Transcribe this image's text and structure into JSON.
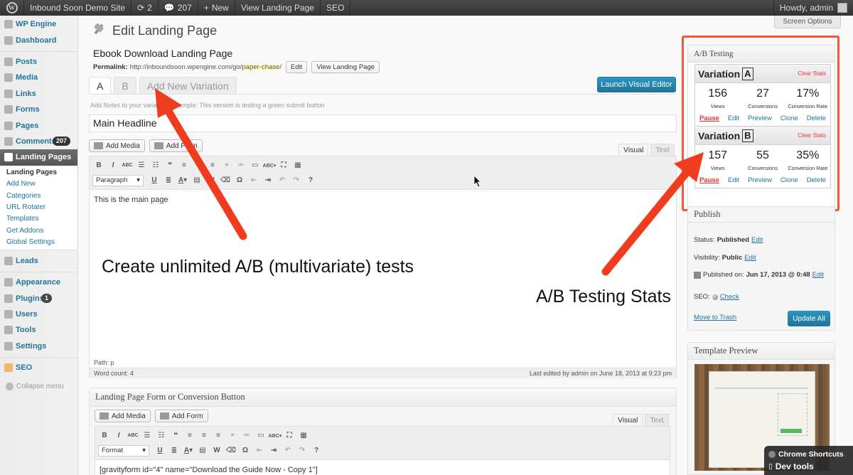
{
  "adminbar": {
    "site": "Inbound Soon Demo Site",
    "updates": "2",
    "comments": "207",
    "new": "New",
    "view": "View Landing Page",
    "seo": "SEO",
    "howdy": "Howdy, admin"
  },
  "sidebar": {
    "items": [
      {
        "label": "WP Engine",
        "icon": "wp-engine-icon"
      },
      {
        "label": "Dashboard",
        "icon": "dashboard-icon"
      },
      {
        "label": "Posts",
        "icon": "pin-icon"
      },
      {
        "label": "Media",
        "icon": "media-icon"
      },
      {
        "label": "Links",
        "icon": "link-icon"
      },
      {
        "label": "Forms",
        "icon": "forms-icon"
      },
      {
        "label": "Pages",
        "icon": "pages-icon"
      },
      {
        "label": "Comments",
        "icon": "comments-icon",
        "badge": "207"
      },
      {
        "label": "Landing Pages",
        "icon": "landing-pages-icon"
      },
      {
        "label": "Leads",
        "icon": "leads-icon"
      },
      {
        "label": "Appearance",
        "icon": "appearance-icon"
      },
      {
        "label": "Plugins",
        "icon": "plugins-icon",
        "badge": "1"
      },
      {
        "label": "Users",
        "icon": "users-icon"
      },
      {
        "label": "Tools",
        "icon": "tools-icon"
      },
      {
        "label": "Settings",
        "icon": "settings-icon"
      },
      {
        "label": "SEO",
        "icon": "seo-icon"
      }
    ],
    "submenu": [
      "Landing Pages",
      "Add New",
      "Categories",
      "URL Rotater",
      "Templates",
      "Get Addons",
      "Global Settings"
    ],
    "collapse": "Collapse menu"
  },
  "page": {
    "title": "Edit Landing Page",
    "screen_options": "Screen Options",
    "post_title": "Ebook Download Landing Page",
    "permalink_label": "Permalink:",
    "permalink_base": "http://inboundsoon.wpengine.com/go/",
    "permalink_slug": "paper-chase",
    "permalink_end": "/",
    "edit_btn": "Edit",
    "view_btn": "View Landing Page"
  },
  "tabs": [
    "A",
    "B",
    "Add New Variation"
  ],
  "launch": "Launch Visual Editor",
  "notes_placeholder": "Add Notes to your variation. Example: This version is testing a green submit button",
  "headline": "Main Headline",
  "editor1": {
    "add_media": "Add Media",
    "add_form": "Add Form",
    "visual": "Visual",
    "text": "Text",
    "format": "Paragraph",
    "content": "This is the main page",
    "path": "Path: p",
    "word_count": "Word count: 4",
    "last_edited": "Last edited by admin on June 18, 2013 at 9:23 pm"
  },
  "form_box": {
    "title": "Landing Page Form or Conversion Button",
    "add_media": "Add Media",
    "add_form": "Add Form",
    "visual": "Visual",
    "text": "Text",
    "format": "Format",
    "content": "[gravityform id=\"4\" name=\"Download the Guide Now - Copy 1\"]"
  },
  "ab": {
    "title": "A/B Testing",
    "variation_label": "Variation",
    "clear": "Clear Stats",
    "variations": [
      {
        "letter": "A",
        "views": "156",
        "conversions": "27",
        "rate": "17%"
      },
      {
        "letter": "B",
        "views": "157",
        "conversions": "55",
        "rate": "35%"
      }
    ],
    "labels": {
      "views": "Views",
      "conversions": "Conversions",
      "rate": "Conversion Rate"
    },
    "actions": [
      "Pause",
      "Edit",
      "Preview",
      "Clone",
      "Delete"
    ]
  },
  "publish": {
    "title": "Publish",
    "status_label": "Status:",
    "status": "Published",
    "visibility_label": "Visibility:",
    "visibility": "Public",
    "published_label": "Published on:",
    "published": "Jun 17, 2013 @ 0:48",
    "edit": "Edit",
    "seo_label": "SEO:",
    "seo_check": "Check",
    "trash": "Move to Trash",
    "update": "Update All"
  },
  "template_preview": {
    "title": "Template Preview"
  },
  "annotations": {
    "left": "Create unlimited A/B (multivariate) tests",
    "right": "A/B Testing Stats"
  },
  "chrome": {
    "line1": "Chrome Shortcuts",
    "line2": "Dev tools"
  },
  "colors": {
    "accent": "#21759b",
    "arrow": "#f03c1e",
    "frame": "#f05a3c"
  }
}
